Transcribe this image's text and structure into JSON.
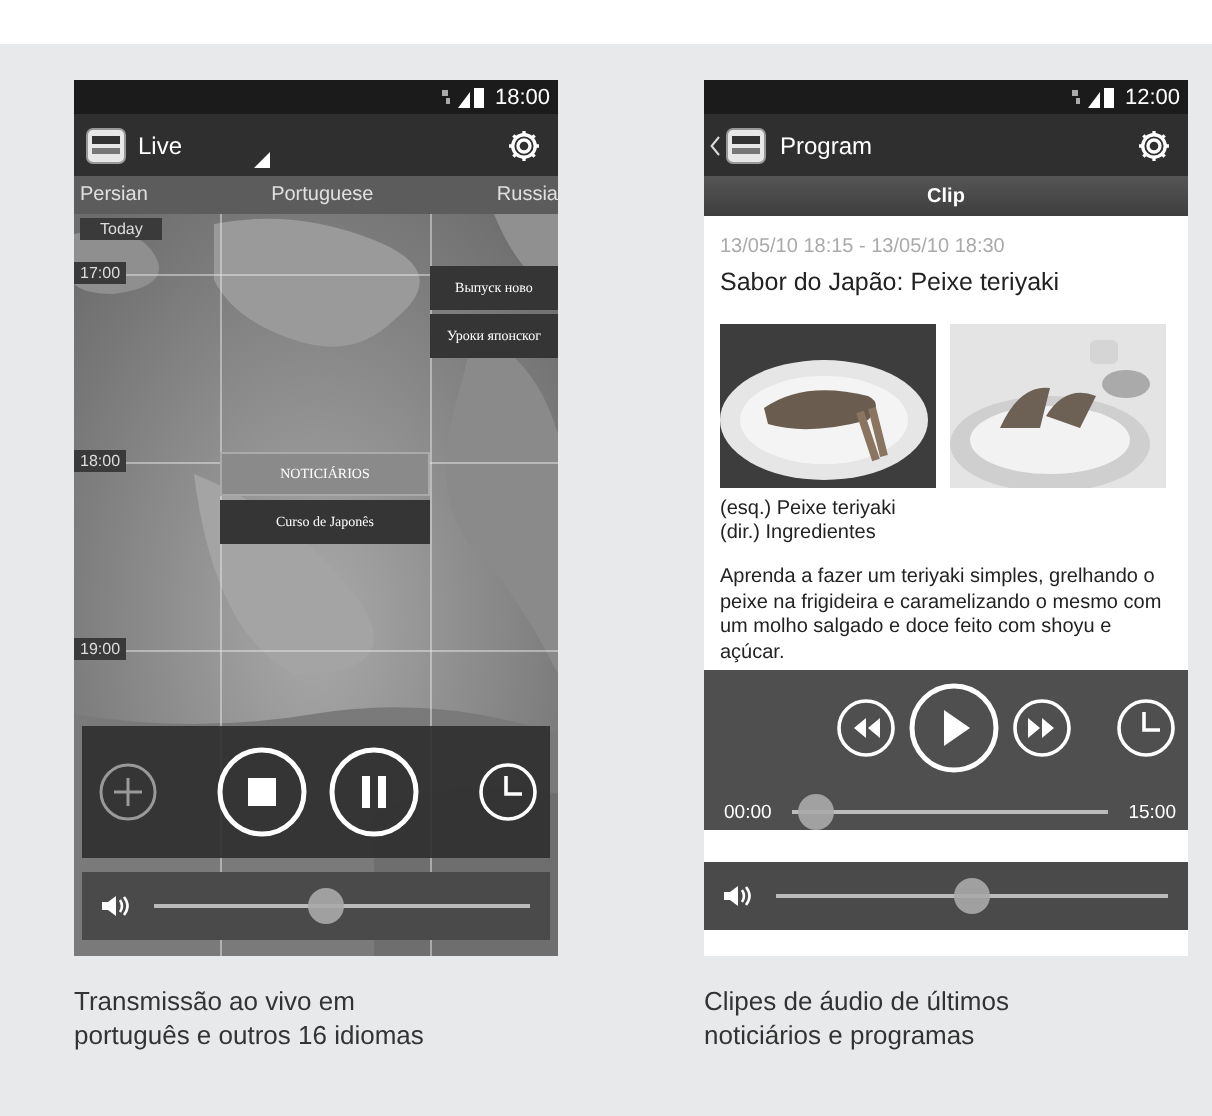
{
  "screens": [
    {
      "kind": "live",
      "status_time": "18:00",
      "app_title": "Live",
      "languages": [
        "Persian",
        "Portuguese",
        "Russia"
      ],
      "day_label": "Today",
      "times": [
        "17:00",
        "18:00",
        "19:00"
      ],
      "columns": [
        {
          "programs": [
            {
              "title": "NOTICIÁRIOS",
              "selected": true
            },
            {
              "title": "Curso de Japonês",
              "selected": false
            }
          ]
        },
        {
          "programs": [
            {
              "title": "Выпуск ново",
              "selected": false
            },
            {
              "title": "Уроки японског",
              "selected": false
            }
          ]
        }
      ],
      "volume": {
        "level": 0.45
      },
      "caption": "Transmissão ao vivo em português e outros 16 idiomas"
    },
    {
      "kind": "clip",
      "status_time": "12:00",
      "app_title": "Program",
      "section": "Clip",
      "datetime": "13/05/10 18:15 - 13/05/10 18:30",
      "title": "Sabor do Japão: Peixe teriyaki",
      "image_captions": [
        "(esq.) Peixe teriyaki",
        "(dir.) Ingredientes"
      ],
      "description": "Aprenda a fazer um teriyaki simples, grelhando o peixe na frigideira e caramelizando o mesmo com um molho salgado e doce feito com shoyu e açúcar.",
      "elapsed": "00:00",
      "duration": "15:00",
      "progress": {
        "level": 0.02
      },
      "volume": {
        "level": 0.5
      },
      "caption": "Clipes de áudio de últimos noticiários e programas"
    }
  ]
}
